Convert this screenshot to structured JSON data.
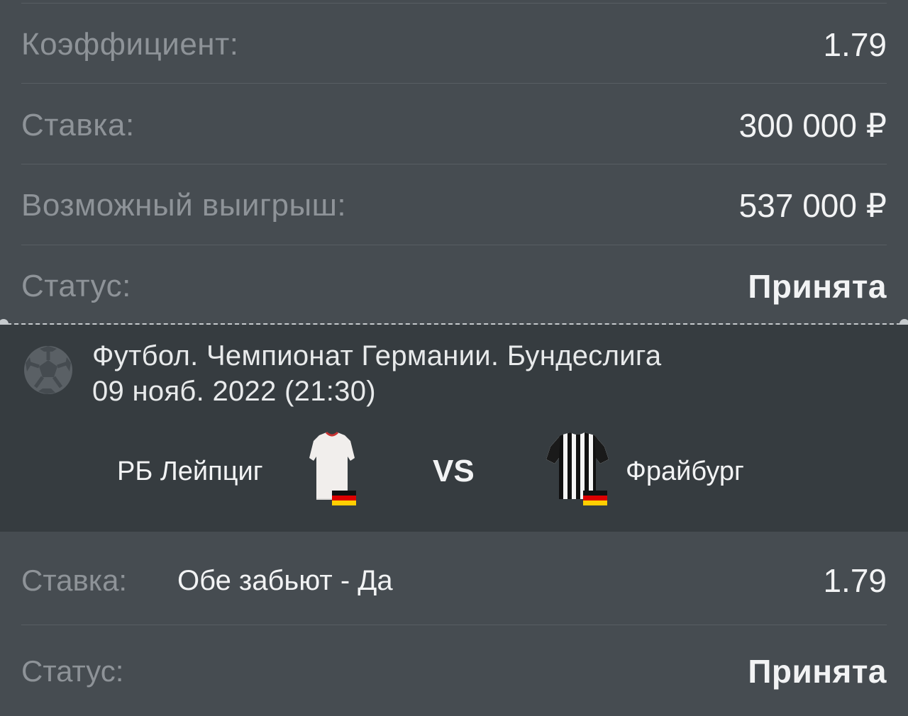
{
  "summary": {
    "coef_label": "Коэффициент:",
    "coef_value": "1.79",
    "stake_label": "Ставка:",
    "stake_value": "300 000 ₽",
    "win_label": "Возможный выигрыш:",
    "win_value": "537 000 ₽",
    "status_label": "Статус:",
    "status_value": "Принята"
  },
  "event": {
    "icon": "football-icon",
    "title": "Футбол. Чемпионат Германии. Бундеслига",
    "date": "09 нояб. 2022 (21:30)",
    "home_team": "РБ Лейпциг",
    "away_team": "Фрайбург",
    "vs": "VS",
    "flag": "germany-flag-icon"
  },
  "bet": {
    "label": "Ставка:",
    "market": "Обе забьют - Да",
    "coef": "1.79",
    "status_label": "Статус:",
    "status_value": "Принята"
  },
  "colors": {
    "background": "#464c51",
    "event_background": "#363c40",
    "label": "#8e9398",
    "value": "#f2f3f4"
  }
}
